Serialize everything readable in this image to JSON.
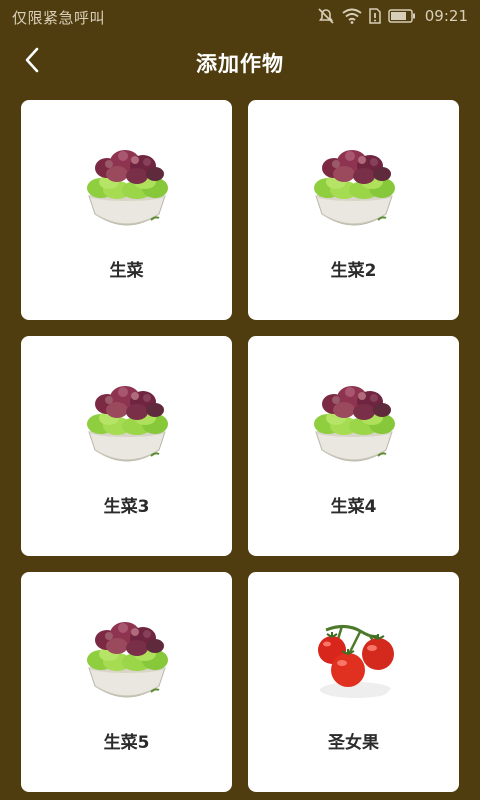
{
  "status_bar": {
    "carrier_text": "仅限紧急呼叫",
    "time": "09:21",
    "icons": [
      "mute-icon",
      "wifi-icon",
      "sim-alert-icon",
      "battery-icon"
    ]
  },
  "header": {
    "title": "添加作物",
    "back_icon": "chevron-left-icon"
  },
  "crops": [
    {
      "name": "生菜",
      "image": "lettuce-bowl"
    },
    {
      "name": "生菜2",
      "image": "lettuce-bowl"
    },
    {
      "name": "生菜3",
      "image": "lettuce-bowl"
    },
    {
      "name": "生菜4",
      "image": "lettuce-bowl"
    },
    {
      "name": "生菜5",
      "image": "lettuce-bowl"
    },
    {
      "name": "圣女果",
      "image": "cherry-tomatoes"
    }
  ],
  "colors": {
    "background": "#4f3d0f",
    "card": "#ffffff",
    "title_text": "#ffffff",
    "card_text": "#2b2b2b"
  }
}
